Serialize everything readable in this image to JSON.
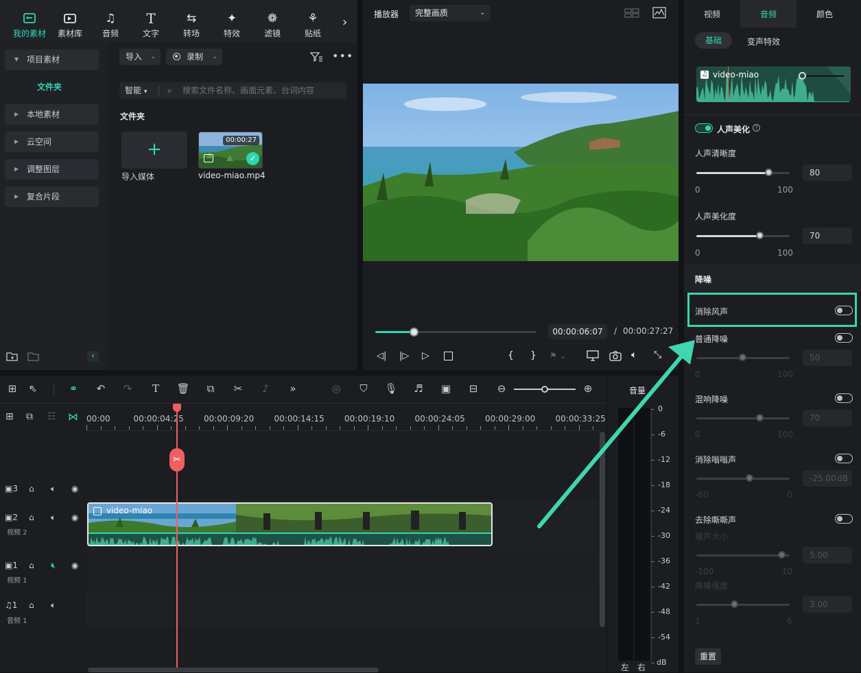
{
  "top_tabs": [
    {
      "label": "我的素材",
      "icon": "my-media-icon",
      "active": true
    },
    {
      "label": "素材库",
      "icon": "stock-media-icon"
    },
    {
      "label": "音频",
      "icon": "music-note-icon"
    },
    {
      "label": "文字",
      "icon": "text-icon"
    },
    {
      "label": "转场",
      "icon": "transition-icon"
    },
    {
      "label": "特效",
      "icon": "effects-icon"
    },
    {
      "label": "滤镜",
      "icon": "filter-icon"
    },
    {
      "label": "贴纸",
      "icon": "sticker-icon"
    }
  ],
  "sidebar": {
    "project_media": "项目素材",
    "folder": "文件夹",
    "items": [
      "本地素材",
      "云空间",
      "调整图层",
      "复合片段"
    ]
  },
  "media_toolbar": {
    "import": "导入",
    "record": "录制",
    "smart": "智能",
    "search_placeholder": "搜索文件名称、画面元素、台词内容"
  },
  "media_area": {
    "folder_title": "文件夹",
    "import_media": "导入媒体",
    "clip_name": "video-miao.mp4",
    "clip_duration": "00:00:27"
  },
  "player": {
    "title": "播放器",
    "quality": "完整画质",
    "current_time": "00:00:06:07",
    "separator": "/",
    "total_time": "00:00:27:27",
    "progress": 0.24
  },
  "props": {
    "tabs": [
      "视频",
      "音频",
      "颜色"
    ],
    "active_tab": "音频",
    "subtabs": [
      "基础",
      "变声特效"
    ],
    "clip_label": "video-miao",
    "voice_enhance": "人声美化",
    "voice_clarity": {
      "label": "人声清晰度",
      "value": "80",
      "min": "0",
      "max": "100"
    },
    "voice_beautify": {
      "label": "人声美化度",
      "value": "70",
      "min": "0",
      "max": "100"
    },
    "denoise_header": "降噪",
    "wind_removal": "消除风声",
    "normal_denoise": {
      "label": "普通降噪",
      "value": "50",
      "min": "0",
      "max": "100"
    },
    "reverb_denoise": {
      "label": "混响降噪",
      "value": "70",
      "min": "0",
      "max": "100"
    },
    "hum_removal": {
      "label": "消除嗡嗡声",
      "value": "-25.00",
      "unit": "dB",
      "min": "-60",
      "max": "0"
    },
    "hiss_removal": {
      "label": "去除嘶嘶声"
    },
    "noise_volume": {
      "label": "噪声大小",
      "value": "5.00",
      "min": "-100",
      "max": "10"
    },
    "denoise_strength": {
      "label": "降噪强度",
      "value": "3.00",
      "min": "1",
      "max": "6"
    },
    "reset": "重置"
  },
  "timeline": {
    "ruler": [
      "00:00",
      "00:00:04:25",
      "00:00:09:20",
      "00:00:14:15",
      "00:00:19:10",
      "00:00:24:05",
      "00:00:29:00",
      "00:00:33:25"
    ],
    "tracks": [
      {
        "num": "3",
        "name": ""
      },
      {
        "num": "2",
        "name": "视频 2"
      },
      {
        "num": "1",
        "name": "视频 1"
      },
      {
        "num": "1",
        "name": "音频 1"
      }
    ],
    "clip_label": "video-miao"
  },
  "meter": {
    "title": "音量",
    "ticks": [
      "0",
      "-6",
      "-12",
      "-18",
      "-24",
      "-30",
      "-36",
      "-42",
      "-48",
      "-54",
      "dB"
    ],
    "left": "左",
    "right": "右"
  },
  "colors": {
    "accent": "#2fd6b4",
    "playhead": "#f05f5f",
    "bg": "#1b1d21"
  }
}
